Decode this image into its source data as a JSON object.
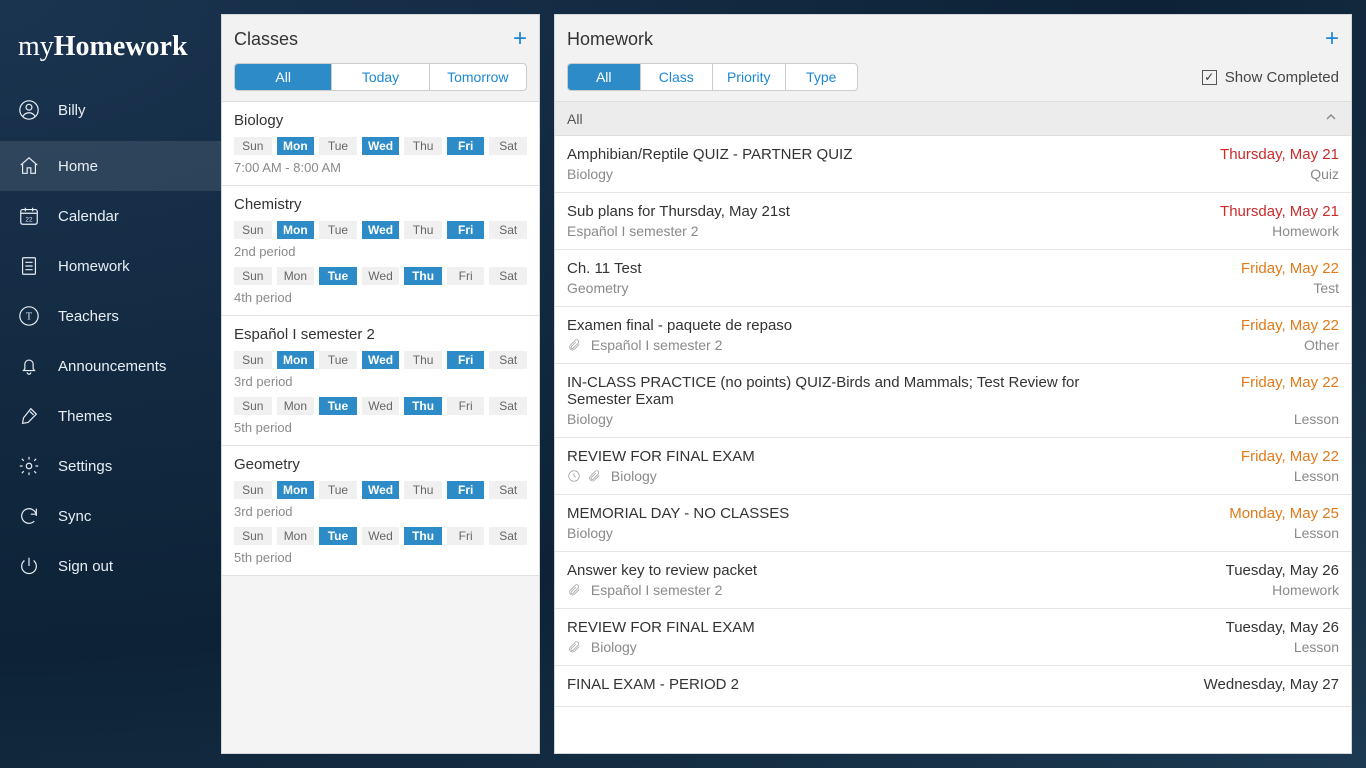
{
  "app": {
    "brand_prefix": "my",
    "brand_main": "Homework"
  },
  "user": {
    "name": "Billy"
  },
  "nav": [
    {
      "label": "Home",
      "icon": "home-icon",
      "active": true
    },
    {
      "label": "Calendar",
      "icon": "calendar-icon",
      "active": false
    },
    {
      "label": "Homework",
      "icon": "homework-icon",
      "active": false
    },
    {
      "label": "Teachers",
      "icon": "teachers-icon",
      "active": false
    },
    {
      "label": "Announcements",
      "icon": "bell-icon",
      "active": false
    },
    {
      "label": "Themes",
      "icon": "themes-icon",
      "active": false
    },
    {
      "label": "Settings",
      "icon": "gear-icon",
      "active": false
    },
    {
      "label": "Sync",
      "icon": "sync-icon",
      "active": false
    },
    {
      "label": "Sign out",
      "icon": "power-icon",
      "active": false
    }
  ],
  "classes_panel": {
    "title": "Classes",
    "tabs": [
      "All",
      "Today",
      "Tomorrow"
    ],
    "active_tab": 0,
    "days_labels": [
      "Sun",
      "Mon",
      "Tue",
      "Wed",
      "Thu",
      "Fri",
      "Sat"
    ],
    "items": [
      {
        "name": "Biology",
        "schedules": [
          {
            "days": [
              false,
              true,
              false,
              true,
              false,
              true,
              false
            ],
            "subtext": "7:00 AM - 8:00 AM"
          }
        ]
      },
      {
        "name": "Chemistry",
        "schedules": [
          {
            "days": [
              false,
              true,
              false,
              true,
              false,
              true,
              false
            ],
            "subtext": "2nd period"
          },
          {
            "days": [
              false,
              false,
              true,
              false,
              true,
              false,
              false
            ],
            "subtext": "4th period"
          }
        ]
      },
      {
        "name": "Español I semester 2",
        "schedules": [
          {
            "days": [
              false,
              true,
              false,
              true,
              false,
              true,
              false
            ],
            "subtext": "3rd period"
          },
          {
            "days": [
              false,
              false,
              true,
              false,
              true,
              false,
              false
            ],
            "subtext": "5th period"
          }
        ]
      },
      {
        "name": "Geometry",
        "schedules": [
          {
            "days": [
              false,
              true,
              false,
              true,
              false,
              true,
              false
            ],
            "subtext": "3rd period"
          },
          {
            "days": [
              false,
              false,
              true,
              false,
              true,
              false,
              false
            ],
            "subtext": "5th period"
          }
        ]
      }
    ]
  },
  "homework_panel": {
    "title": "Homework",
    "tabs": [
      "All",
      "Class",
      "Priority",
      "Type"
    ],
    "active_tab": 0,
    "show_completed_label": "Show Completed",
    "show_completed_checked": true,
    "group_label": "All",
    "items": [
      {
        "title": "Amphibian/Reptile QUIZ - PARTNER QUIZ",
        "className": "Biology",
        "due": "Thursday, May 21",
        "dueColor": "red",
        "type": "Quiz",
        "icons": []
      },
      {
        "title": "Sub plans for Thursday, May 21st",
        "className": "Español I semester 2",
        "due": "Thursday, May 21",
        "dueColor": "red",
        "type": "Homework",
        "icons": []
      },
      {
        "title": "Ch. 11 Test",
        "className": "Geometry",
        "due": "Friday, May 22",
        "dueColor": "orange",
        "type": "Test",
        "icons": []
      },
      {
        "title": "Examen final - paquete de repaso",
        "className": "Español I semester 2",
        "due": "Friday, May 22",
        "dueColor": "orange",
        "type": "Other",
        "icons": [
          "attachment"
        ]
      },
      {
        "title": "IN-CLASS PRACTICE (no points) QUIZ-Birds and Mammals; Test Review for Semester Exam",
        "className": "Biology",
        "due": "Friday, May 22",
        "dueColor": "orange",
        "type": "Lesson",
        "icons": []
      },
      {
        "title": "REVIEW FOR FINAL EXAM",
        "className": "Biology",
        "due": "Friday, May 22",
        "dueColor": "orange",
        "type": "Lesson",
        "icons": [
          "clock",
          "attachment"
        ]
      },
      {
        "title": "MEMORIAL DAY - NO CLASSES",
        "className": "Biology",
        "due": "Monday, May 25",
        "dueColor": "orange",
        "type": "Lesson",
        "icons": []
      },
      {
        "title": "Answer key to review packet",
        "className": "Español I semester 2",
        "due": "Tuesday, May 26",
        "dueColor": "normal",
        "type": "Homework",
        "icons": [
          "attachment"
        ]
      },
      {
        "title": "REVIEW FOR FINAL EXAM",
        "className": "Biology",
        "due": "Tuesday, May 26",
        "dueColor": "normal",
        "type": "Lesson",
        "icons": [
          "attachment"
        ]
      },
      {
        "title": "FINAL EXAM - PERIOD 2",
        "className": "",
        "due": "Wednesday, May 27",
        "dueColor": "normal",
        "type": "",
        "icons": []
      }
    ]
  }
}
